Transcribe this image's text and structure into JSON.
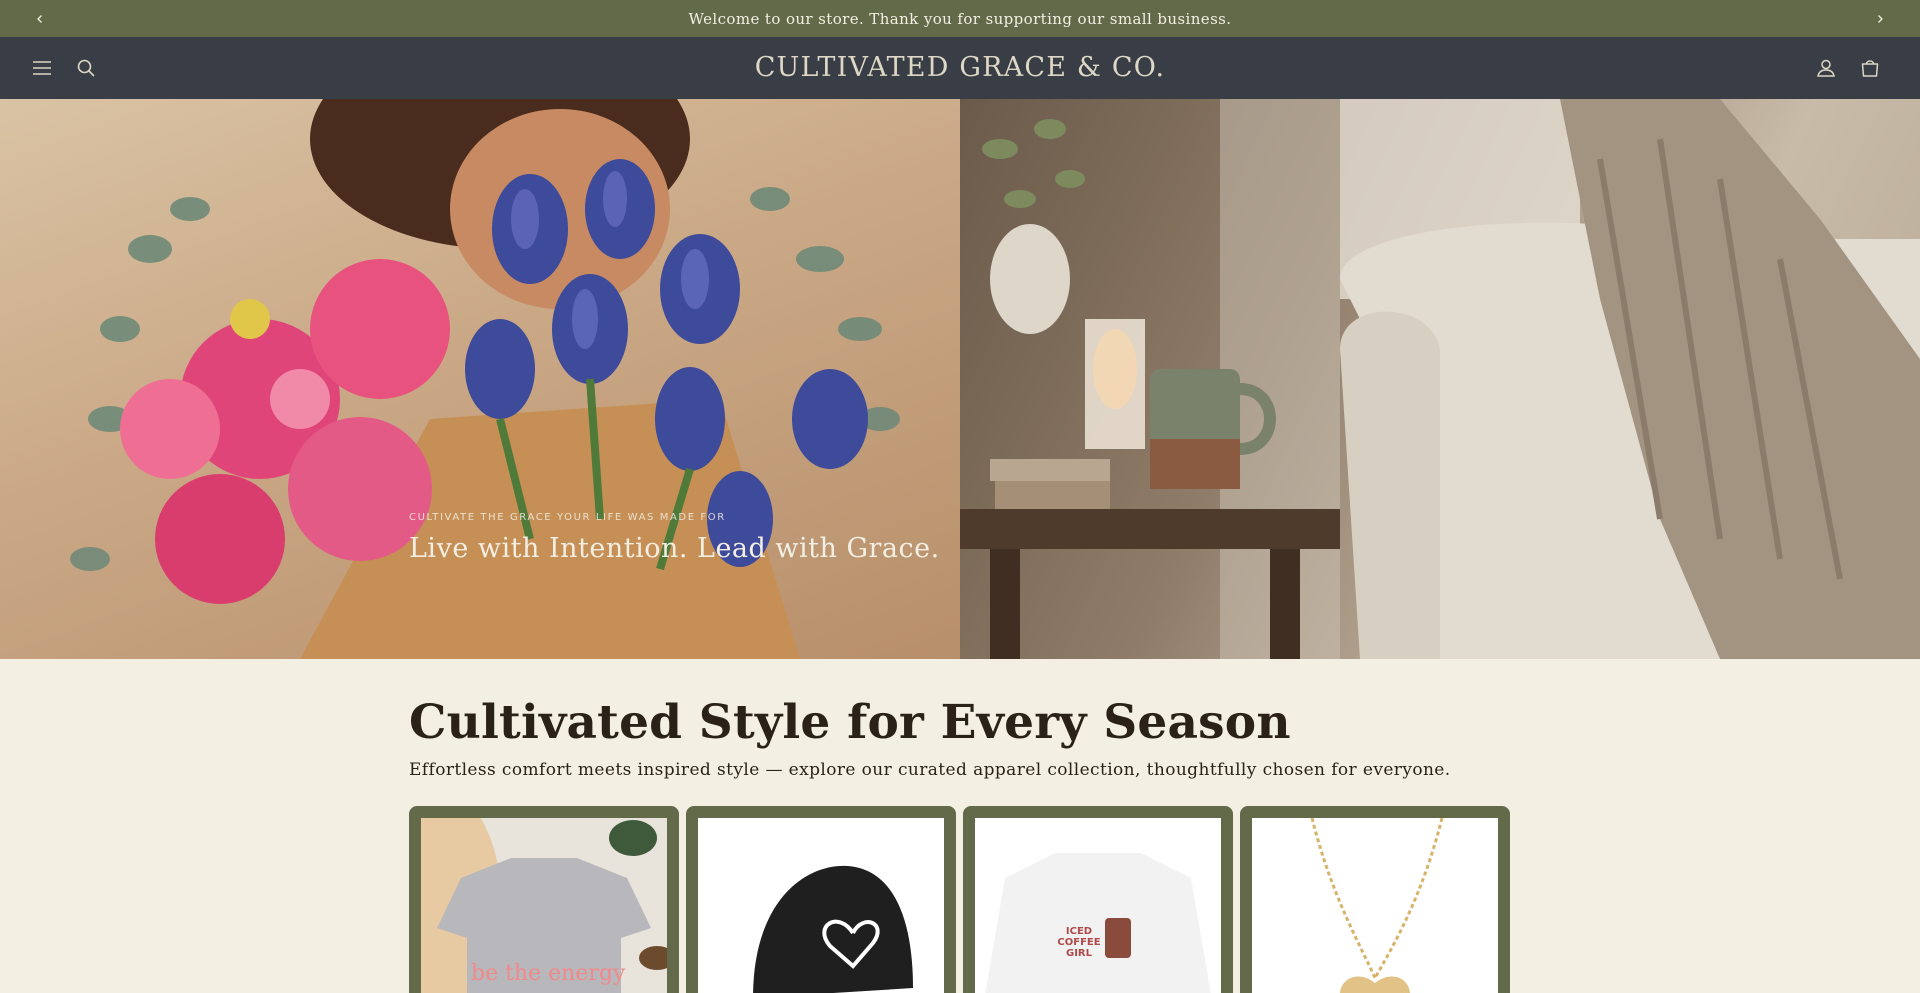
{
  "announcement": {
    "text": "Welcome to our store. Thank you for supporting our small business.",
    "prev_icon": "chevron-left-icon",
    "next_icon": "chevron-right-icon"
  },
  "header": {
    "logo": "CULTIVATED GRACE & CO.",
    "menu_icon": "hamburger-menu-icon",
    "search_icon": "search-icon",
    "account_icon": "account-icon",
    "cart_icon": "cart-icon"
  },
  "hero": {
    "eyebrow": "CULTIVATE THE GRACE YOUR LIFE WAS MADE FOR",
    "heading": "Live with Intention. Lead with Grace."
  },
  "collection": {
    "title": "Cultivated Style for Every Season",
    "subtitle": "Effortless comfort meets inspired style — explore our curated apparel collection, thoughtfully chosen for everyone.",
    "products": [
      {
        "name": "be the energy tee",
        "print": "be the energy"
      },
      {
        "name": "heart baseball cap"
      },
      {
        "name": "iced coffee girl sweatshirt",
        "print": "ICED COFFEE GIRL"
      },
      {
        "name": "gold heart necklace"
      }
    ]
  },
  "colors": {
    "announcement_bg": "#626a4a",
    "header_bg": "#393d45",
    "page_bg": "#f3efe3",
    "card_frame": "#626a4a"
  }
}
